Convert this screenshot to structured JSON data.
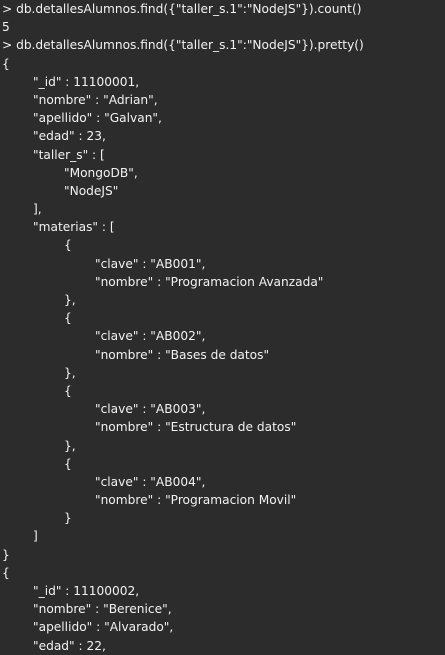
{
  "terminal": {
    "lines": [
      "> db.detallesAlumnos.find({\"taller_s.1\":\"NodeJS\"}).count()",
      "5",
      "> db.detallesAlumnos.find({\"taller_s.1\":\"NodeJS\"}).pretty()",
      "{",
      "        \"_id\" : 11100001,",
      "        \"nombre\" : \"Adrian\",",
      "        \"apellido\" : \"Galvan\",",
      "        \"edad\" : 23,",
      "        \"taller_s\" : [",
      "                \"MongoDB\",",
      "                \"NodeJS\"",
      "        ],",
      "        \"materias\" : [",
      "                {",
      "                        \"clave\" : \"AB001\",",
      "                        \"nombre\" : \"Programacion Avanzada\"",
      "                },",
      "                {",
      "                        \"clave\" : \"AB002\",",
      "                        \"nombre\" : \"Bases de datos\"",
      "                },",
      "                {",
      "                        \"clave\" : \"AB003\",",
      "                        \"nombre\" : \"Estructura de datos\"",
      "                },",
      "                {",
      "                        \"clave\" : \"AB004\",",
      "                        \"nombre\" : \"Programacion Movil\"",
      "                }",
      "        ]",
      "}",
      "{",
      "        \"_id\" : 11100002,",
      "        \"nombre\" : \"Berenice\",",
      "        \"apellido\" : \"Alvarado\",",
      "        \"edad\" : 22,"
    ]
  }
}
